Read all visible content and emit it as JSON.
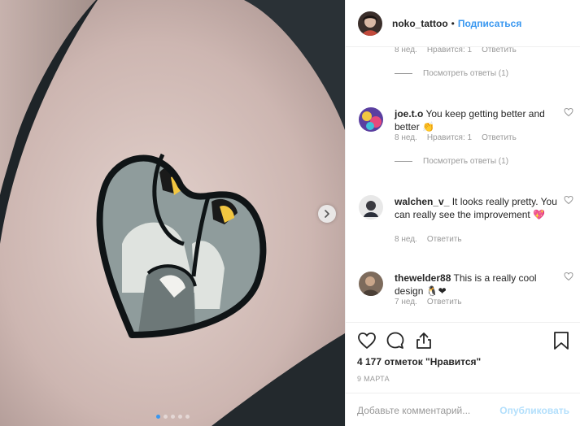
{
  "header": {
    "username": "noko_tattoo",
    "separator": "•",
    "follow_label": "Подписаться"
  },
  "comments": {
    "partial_meta": {
      "time": "8 нед.",
      "likes": "Нравится: 1",
      "reply": "Ответить"
    },
    "view_replies_1": "Посмотреть ответы (1)",
    "items": [
      {
        "username": "joe.t.o",
        "text": "You keep getting better and better 👏",
        "time": "8 нед.",
        "likes": "Нравится: 1",
        "reply": "Ответить"
      },
      {
        "username": "walchen_v_",
        "text": "It looks really pretty. You can really see the improvement 💖",
        "time": "8 нед.",
        "reply": "Ответить"
      },
      {
        "username": "thewelder88",
        "text": "This is a really cool design 🐧❤",
        "time": "7 нед.",
        "reply": "Ответить"
      }
    ],
    "view_replies_2": "Посмотреть ответы (1)"
  },
  "actions": {
    "likes_text": "4 177 отметок \"Нравится\"",
    "date": "9 МАРТА",
    "comment_placeholder": "Добавьте комментарий...",
    "publish_label": "Опубликовать"
  },
  "carousel": {
    "total": 5,
    "active": 1
  },
  "icons": {
    "like": "heart-icon",
    "comment": "comment-icon",
    "share": "share-icon",
    "save": "bookmark-icon",
    "next": "chevron-right-icon"
  },
  "colors": {
    "accent": "#3897f0",
    "muted": "#999999",
    "publish_disabled": "#b2dffc"
  }
}
